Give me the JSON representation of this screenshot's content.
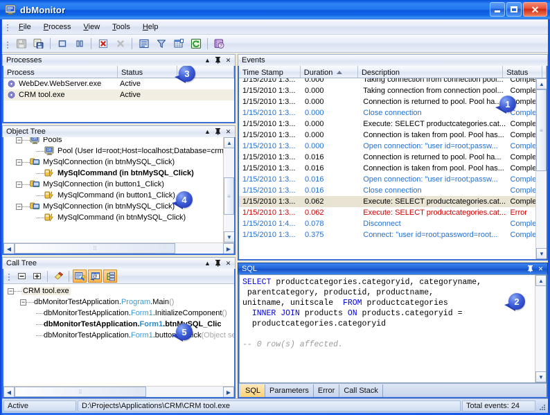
{
  "window": {
    "title": "dbMonitor",
    "icon": "monitor-icon",
    "minimize_label": "Minimize",
    "maximize_label": "Maximize",
    "close_label": "Close"
  },
  "menu": {
    "items": [
      {
        "label": "File",
        "accel": "F"
      },
      {
        "label": "Process",
        "accel": "P"
      },
      {
        "label": "View",
        "accel": "V"
      },
      {
        "label": "Tools",
        "accel": "T"
      },
      {
        "label": "Help",
        "accel": "H"
      }
    ]
  },
  "toolbar": {
    "buttons": [
      {
        "name": "save-icon",
        "enabled": false
      },
      {
        "name": "save-as-icon",
        "enabled": true
      },
      {
        "sep": true
      },
      {
        "name": "stop-icon",
        "enabled": true
      },
      {
        "name": "pause-icon",
        "enabled": true
      },
      {
        "sep": true
      },
      {
        "name": "delete-icon",
        "enabled": true
      },
      {
        "name": "clear-icon",
        "enabled": false
      },
      {
        "sep": true
      },
      {
        "name": "properties-icon",
        "enabled": true
      },
      {
        "name": "filter-icon",
        "enabled": true
      },
      {
        "name": "columns-icon",
        "enabled": true
      },
      {
        "name": "refresh-icon",
        "enabled": true
      },
      {
        "sep": true
      },
      {
        "name": "help-icon",
        "enabled": true
      }
    ]
  },
  "processes_panel": {
    "title": "Processes",
    "columns": [
      "Process",
      "Status",
      ""
    ],
    "rows": [
      {
        "process": "WebDev.WebServer.exe",
        "status": "Active",
        "icon": "gear-icon"
      },
      {
        "process": "CRM tool.exe",
        "status": "Active",
        "icon": "gear-icon"
      }
    ]
  },
  "object_tree_panel": {
    "title": "Object Tree",
    "nodes": [
      {
        "indent": 1,
        "expander": "-",
        "icon": "db-monitor-icon",
        "label": "Pools",
        "bold": false
      },
      {
        "indent": 2,
        "expander": "",
        "icon": "db-monitor-icon",
        "label": "Pool (User Id=root;Host=localhost;Database=crm",
        "bold": false
      },
      {
        "indent": 1,
        "expander": "-",
        "icon": "connection-icon",
        "label": "MySqlConnection (in btnMySQL_Click)",
        "bold": false
      },
      {
        "indent": 2,
        "expander": "",
        "icon": "command-icon",
        "label": "MySqlCommand (in btnMySQL_Click)",
        "bold": true
      },
      {
        "indent": 1,
        "expander": "-",
        "icon": "connection-icon",
        "label": "MySqlConnection (in button1_Click)",
        "bold": false
      },
      {
        "indent": 2,
        "expander": "",
        "icon": "command-icon",
        "label": "MySqlCommand (in button1_Click)",
        "bold": false
      },
      {
        "indent": 1,
        "expander": "-",
        "icon": "connection-icon",
        "label": "MySqlConnection (in btnMySQL_Click)",
        "bold": false
      },
      {
        "indent": 2,
        "expander": "",
        "icon": "command-icon",
        "label": "MySqlCommand (in btnMySQL_Click)",
        "bold": false
      }
    ]
  },
  "call_tree_panel": {
    "title": "Call Tree",
    "toolbar": [
      {
        "name": "collapse-all-icon",
        "active": false
      },
      {
        "name": "expand-all-icon",
        "active": false
      },
      {
        "sep": true
      },
      {
        "name": "clear-icon",
        "active": false
      },
      {
        "sep": true
      },
      {
        "name": "show-properties-icon",
        "active": true
      },
      {
        "name": "show-parameters-icon",
        "active": true
      },
      {
        "name": "show-hierarchy-icon",
        "active": true
      }
    ],
    "nodes": [
      {
        "indent": 0,
        "expander": "-",
        "label": "CRM tool.exe",
        "selected": true,
        "parts": [
          {
            "t": "CRM tool.exe",
            "c": "plain"
          }
        ]
      },
      {
        "indent": 1,
        "expander": "-",
        "label": "dbMonitorTestApplication.Program.Main()",
        "parts": [
          {
            "t": "dbMonitorTestApplication.",
            "c": "plain"
          },
          {
            "t": "Program",
            "c": "type"
          },
          {
            "t": ".Main",
            "c": "plain"
          },
          {
            "t": "()",
            "c": "dim"
          }
        ]
      },
      {
        "indent": 2,
        "expander": "",
        "label": "dbMonitorTestApplication.Form1.InitializeComponent()",
        "parts": [
          {
            "t": "dbMonitorTestApplication.",
            "c": "plain"
          },
          {
            "t": "Form1",
            "c": "type"
          },
          {
            "t": ".InitializeComponent",
            "c": "plain"
          },
          {
            "t": "()",
            "c": "dim"
          }
        ]
      },
      {
        "indent": 2,
        "expander": "",
        "label": "dbMonitorTestApplication.Form1.btnMySQL_Click",
        "bold": true,
        "parts": [
          {
            "t": "dbMonitorTestApplication.",
            "c": "plain"
          },
          {
            "t": "Form1",
            "c": "type"
          },
          {
            "t": ".btnMySQL_Click",
            "c": "plain"
          }
        ]
      },
      {
        "indent": 2,
        "expander": "",
        "label": "dbMonitorTestApplication.Form1.button1_Click(Object se",
        "parts": [
          {
            "t": "dbMonitorTestApplication.",
            "c": "plain"
          },
          {
            "t": "Form1",
            "c": "type"
          },
          {
            "t": ".button1_Click",
            "c": "plain"
          },
          {
            "t": "(Object se",
            "c": "dim"
          }
        ]
      }
    ]
  },
  "events_panel": {
    "title": "Events",
    "columns": [
      {
        "label": "Time Stamp",
        "sorted": false
      },
      {
        "label": "Duration",
        "sorted": true,
        "sort_dir": "asc"
      },
      {
        "label": "Description",
        "sorted": false
      },
      {
        "label": "Status",
        "sorted": false
      }
    ],
    "rows": [
      {
        "ts": "1/15/2010 1:3...",
        "dur": "0.000",
        "desc": "Taking connection from connection pool...",
        "status": "Complete",
        "color": "black",
        "clipped_top": true
      },
      {
        "ts": "1/15/2010 1:3...",
        "dur": "0.000",
        "desc": "Taking connection from connection pool...",
        "status": "Complete",
        "color": "black"
      },
      {
        "ts": "1/15/2010 1:3...",
        "dur": "0.000",
        "desc": "Connection is returned to pool. Pool ha...",
        "status": "Complete",
        "color": "black"
      },
      {
        "ts": "1/15/2010 1:3...",
        "dur": "0.000",
        "desc": "Close connection",
        "status": "Complete",
        "color": "blue"
      },
      {
        "ts": "1/15/2010 1:3...",
        "dur": "0.000",
        "desc": "Execute: SELECT productcategories.cat...",
        "status": "Complete",
        "color": "black"
      },
      {
        "ts": "1/15/2010 1:3...",
        "dur": "0.000",
        "desc": "Connection is taken from pool. Pool has...",
        "status": "Complete",
        "color": "black"
      },
      {
        "ts": "1/15/2010 1:3...",
        "dur": "0.000",
        "desc": "Open connection: \"user id=root;passw...",
        "status": "Complete",
        "color": "blue"
      },
      {
        "ts": "1/15/2010 1:3...",
        "dur": "0.016",
        "desc": "Connection is returned to pool. Pool ha...",
        "status": "Complete",
        "color": "black"
      },
      {
        "ts": "1/15/2010 1:3...",
        "dur": "0.016",
        "desc": "Connection is taken from pool. Pool has...",
        "status": "Complete",
        "color": "black"
      },
      {
        "ts": "1/15/2010 1:3...",
        "dur": "0.016",
        "desc": "Open connection: \"user id=root;passw...",
        "status": "Complete",
        "color": "blue"
      },
      {
        "ts": "1/15/2010 1:3...",
        "dur": "0.016",
        "desc": "Close connection",
        "status": "Complete",
        "color": "blue"
      },
      {
        "ts": "1/15/2010 1:3...",
        "dur": "0.062",
        "desc": "Execute: SELECT productcategories.cat...",
        "status": "Complete",
        "color": "black",
        "selected": true
      },
      {
        "ts": "1/15/2010 1:3...",
        "dur": "0.062",
        "desc": "Execute: SELECT productcategories.cat...",
        "status": "Error",
        "color": "red"
      },
      {
        "ts": "1/15/2010 1:4...",
        "dur": "0.078",
        "desc": "Disconnect",
        "status": "Complete",
        "color": "blue"
      },
      {
        "ts": "1/15/2010 1:3...",
        "dur": "0.375",
        "desc": "Connect: \"user id=root;password=root...",
        "status": "Complete",
        "color": "blue"
      }
    ]
  },
  "sql_panel": {
    "title": "SQL",
    "lines": [
      [
        {
          "t": "SELECT",
          "c": "kw"
        },
        {
          "t": " productcategories.categoryid, categoryname,",
          "c": "plain"
        }
      ],
      [
        {
          "t": " parentcategory, productid, productname,",
          "c": "plain"
        }
      ],
      [
        {
          "t": "unitname, unitscale  ",
          "c": "plain"
        },
        {
          "t": "FROM",
          "c": "kw"
        },
        {
          "t": " productcategories",
          "c": "plain"
        }
      ],
      [
        {
          "t": "  ",
          "c": "plain"
        },
        {
          "t": "INNER JOIN",
          "c": "kw"
        },
        {
          "t": " products ",
          "c": "plain"
        },
        {
          "t": "ON",
          "c": "kw"
        },
        {
          "t": " products.categoryid =",
          "c": "plain"
        }
      ],
      [
        {
          "t": "  productcategories.categoryid",
          "c": "plain"
        }
      ],
      [
        {
          "t": "",
          "c": "plain"
        }
      ],
      [
        {
          "t": "-- 0 row(s) affected.",
          "c": "cmt"
        }
      ]
    ],
    "tabs": [
      {
        "label": "SQL",
        "selected": true
      },
      {
        "label": "Parameters",
        "selected": false
      },
      {
        "label": "Error",
        "selected": false
      },
      {
        "label": "Call Stack",
        "selected": false
      }
    ]
  },
  "statusbar": {
    "state": "Active",
    "path": "D:\\Projects\\Applications\\CRM\\CRM tool.exe",
    "total_events": "Total events: 24"
  },
  "callouts": [
    {
      "number": "1",
      "target": "events-panel"
    },
    {
      "number": "2",
      "target": "sql-panel"
    },
    {
      "number": "3",
      "target": "processes-panel"
    },
    {
      "number": "4",
      "target": "object-tree-panel"
    },
    {
      "number": "5",
      "target": "call-tree-panel"
    }
  ],
  "colors": {
    "accent": "#1f62d8",
    "title_blue": "#0a54d6",
    "event_blue": "#1f6fd8",
    "event_red": "#d00000",
    "selected_row": "#e8e3d3",
    "tab_selected": "#ffd277"
  }
}
